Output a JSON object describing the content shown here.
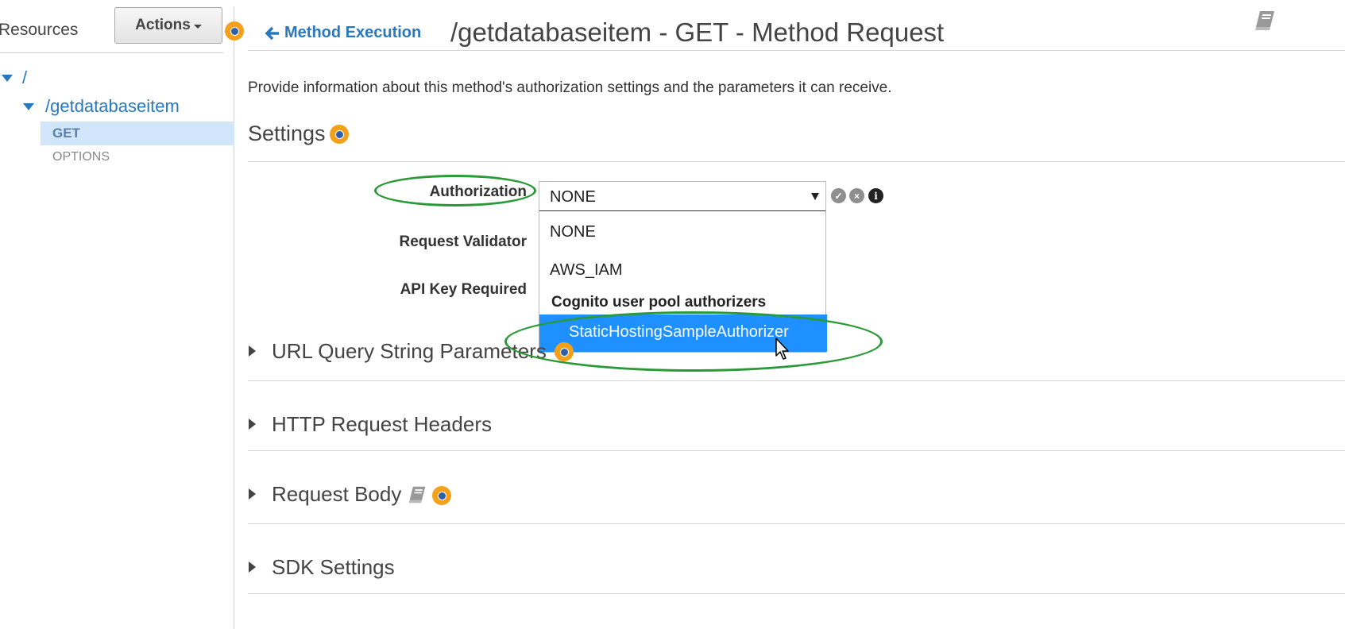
{
  "sidebar": {
    "resources_label": "Resources",
    "actions_label": "Actions",
    "tree": {
      "root": "/",
      "resource": "/getdatabaseitem",
      "methods": [
        "GET",
        "OPTIONS"
      ]
    }
  },
  "header": {
    "back_link": "Method Execution",
    "title": "/getdatabaseitem - GET - Method Request"
  },
  "description": "Provide information about this method's authorization settings and the parameters it can receive.",
  "settings": {
    "title": "Settings",
    "fields": {
      "authorization_label": "Authorization",
      "request_validator_label": "Request Validator",
      "api_key_label": "API Key Required"
    },
    "authorization_select": {
      "value": "NONE",
      "options": [
        "NONE",
        "AWS_IAM"
      ],
      "group_label": "Cognito user pool authorizers",
      "highlighted_option": "StaticHostingSampleAuthorizer"
    }
  },
  "sections": [
    "URL Query String Parameters",
    "HTTP Request Headers",
    "Request Body",
    "SDK Settings"
  ],
  "icons": {
    "back": "arrow-left-icon",
    "book": "book-icon",
    "info": "info-icon",
    "confirm": "check-circle-icon",
    "cancel": "x-circle-icon"
  },
  "colors": {
    "link": "#2878be",
    "highlight": "#1e90ff",
    "selected_row": "#d1e6fa",
    "badge": "#f5a01a",
    "annotation": "#2a9a38"
  }
}
